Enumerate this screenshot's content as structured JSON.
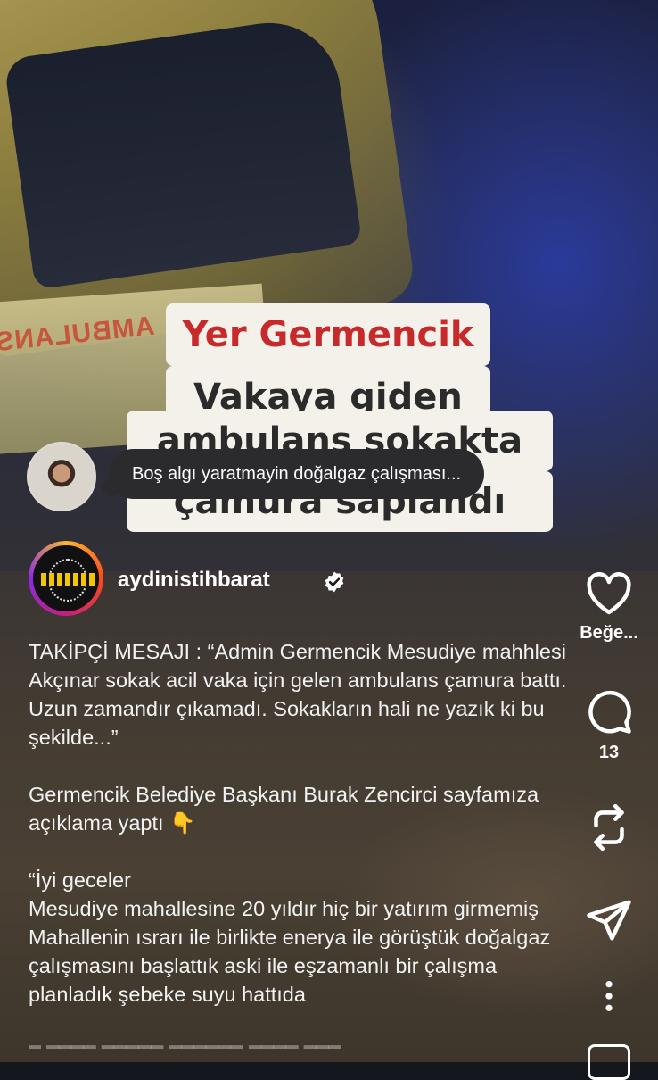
{
  "video": {
    "caption_lines": [
      "Yer Germencik",
      "Vakaya giden",
      "ambulans sokakta",
      "çamura saplandı"
    ],
    "ambulance_side_text": "AMBULANS"
  },
  "comment_preview": {
    "text": "Boş algı yaratmayin doğalgaz çalışması..."
  },
  "author": {
    "username": "aydinistihbarat",
    "verified": true
  },
  "description": {
    "text": "TAKİPÇİ MESAJI : “Admin Germencik Mesudiye mahhlesi Akçınar sokak acil vaka için gelen ambulans çamura battı. Uzun zamandır çıkamadı. Sokakların hali ne yazık ki bu şekilde...”\n\nGermencik Belediye Başkanı Burak Zencirci sayfamıza açıklama yaptı 👇\n\n“İyi geceler\nMesudiye mahallesine 20 yıldır hiç bir yatırım girmemiş\nMahallenin ısrarı ile birlikte enerya ile görüştük doğalgaz çalışmasını başlattık aski ile eşzamanlı bir çalışma planladık şebeke suyu hattıda"
  },
  "actions": {
    "like_label": "Beğe...",
    "comment_count": "13",
    "icons": [
      "heart-icon",
      "comment-icon",
      "repost-icon",
      "share-icon",
      "more-icon"
    ]
  },
  "colors": {
    "caption_red": "#c62a2a",
    "caption_bg": "#f3f1ea",
    "bubble_bg": "#2b2b2d"
  }
}
